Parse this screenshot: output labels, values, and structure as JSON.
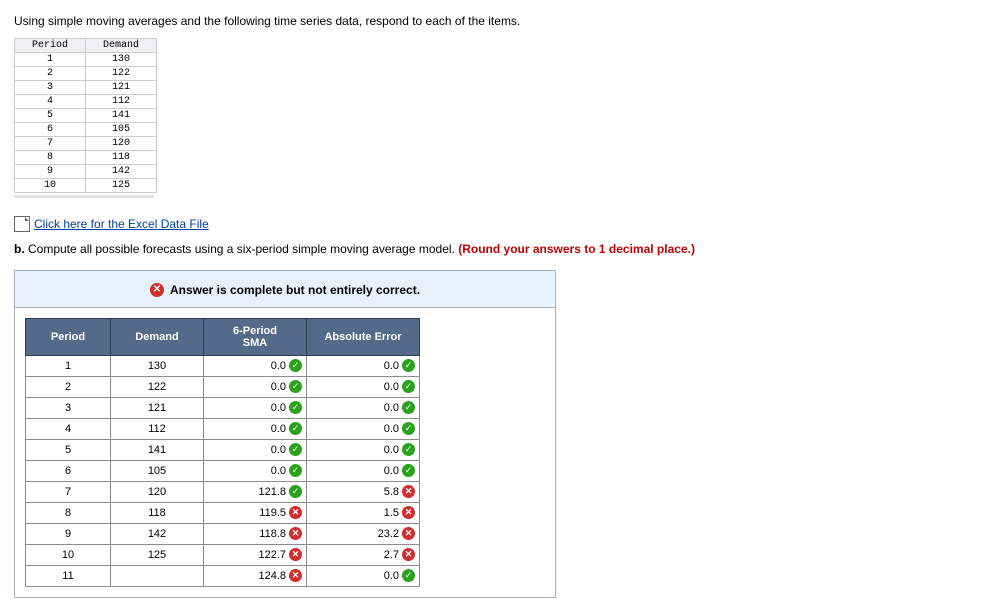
{
  "prompt": "Using simple moving averages and the following time series data, respond to each of the items.",
  "small_table": {
    "headers": [
      "Period",
      "Demand"
    ],
    "rows": [
      {
        "period": "1",
        "demand": "130"
      },
      {
        "period": "2",
        "demand": "122"
      },
      {
        "period": "3",
        "demand": "121"
      },
      {
        "period": "4",
        "demand": "112"
      },
      {
        "period": "5",
        "demand": "141"
      },
      {
        "period": "6",
        "demand": "105"
      },
      {
        "period": "7",
        "demand": "120"
      },
      {
        "period": "8",
        "demand": "118"
      },
      {
        "period": "9",
        "demand": "142"
      },
      {
        "period": "10",
        "demand": "125"
      }
    ]
  },
  "excel_link": "Click here for the Excel Data File",
  "part_b_prefix": "b. ",
  "part_b_text": "Compute all possible forecasts using a six-period simple moving average model. ",
  "part_b_note": "(Round your answers to 1 decimal place.)",
  "banner": "Answer is complete but not entirely correct.",
  "result_headers": {
    "period": "Period",
    "demand": "Demand",
    "sma": "6-Period\nSMA",
    "err": "Absolute Error"
  },
  "results": [
    {
      "period": "1",
      "demand": "130",
      "sma": "0.0",
      "sma_ok": true,
      "err": "0.0",
      "err_ok": true
    },
    {
      "period": "2",
      "demand": "122",
      "sma": "0.0",
      "sma_ok": true,
      "err": "0.0",
      "err_ok": true
    },
    {
      "period": "3",
      "demand": "121",
      "sma": "0.0",
      "sma_ok": true,
      "err": "0.0",
      "err_ok": true
    },
    {
      "period": "4",
      "demand": "112",
      "sma": "0.0",
      "sma_ok": true,
      "err": "0.0",
      "err_ok": true
    },
    {
      "period": "5",
      "demand": "141",
      "sma": "0.0",
      "sma_ok": true,
      "err": "0.0",
      "err_ok": true
    },
    {
      "period": "6",
      "demand": "105",
      "sma": "0.0",
      "sma_ok": true,
      "err": "0.0",
      "err_ok": true
    },
    {
      "period": "7",
      "demand": "120",
      "sma": "121.8",
      "sma_ok": true,
      "err": "5.8",
      "err_ok": false
    },
    {
      "period": "8",
      "demand": "118",
      "sma": "119.5",
      "sma_ok": false,
      "err": "1.5",
      "err_ok": false
    },
    {
      "period": "9",
      "demand": "142",
      "sma": "118.8",
      "sma_ok": false,
      "err": "23.2",
      "err_ok": false
    },
    {
      "period": "10",
      "demand": "125",
      "sma": "122.7",
      "sma_ok": false,
      "err": "2.7",
      "err_ok": false
    },
    {
      "period": "11",
      "demand": "",
      "sma": "124.8",
      "sma_ok": false,
      "err": "0.0",
      "err_ok": true
    }
  ]
}
